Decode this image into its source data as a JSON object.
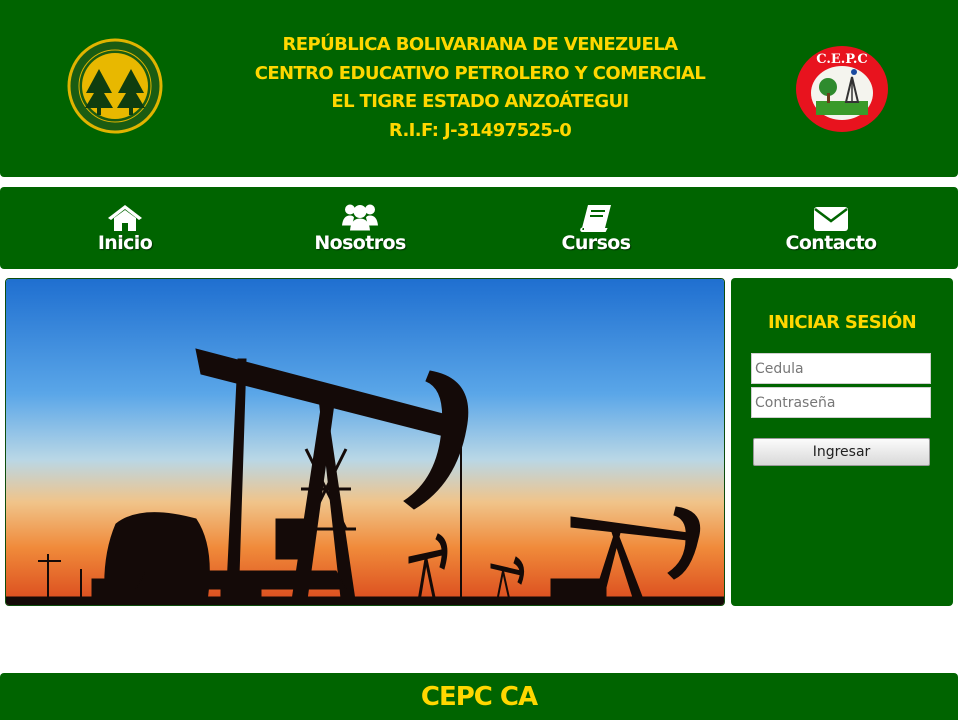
{
  "header": {
    "line1": "REPÚBLICA BOLIVARIANA DE VENEZUELA",
    "line2": "CENTRO EDUCATIVO PETROLERO Y COMERCIAL",
    "line3": "EL TIGRE ESTADO ANZOÁTEGUI",
    "line4": "R.I.F: J-31497525-0",
    "logo_left_icon": "cooperativa-cepc-logo",
    "logo_right_icon": "cepc-logo",
    "logo_right_text": "C.E.P.C",
    "colors": {
      "brand_green": "#006400",
      "title_gold": "#ffd700"
    }
  },
  "nav": {
    "items": [
      {
        "label": "Inicio",
        "icon": "home-icon"
      },
      {
        "label": "Nosotros",
        "icon": "users-icon"
      },
      {
        "label": "Cursos",
        "icon": "book-icon"
      },
      {
        "label": "Contacto",
        "icon": "envelope-icon"
      }
    ]
  },
  "hero": {
    "icon": "oil-pumpjack-sunset-image"
  },
  "login": {
    "title": "INICIAR SESIÓN",
    "cedula_placeholder": "Cedula",
    "password_placeholder": "Contraseña",
    "submit_label": "Ingresar"
  },
  "footer": {
    "title": "CEPC CA"
  }
}
